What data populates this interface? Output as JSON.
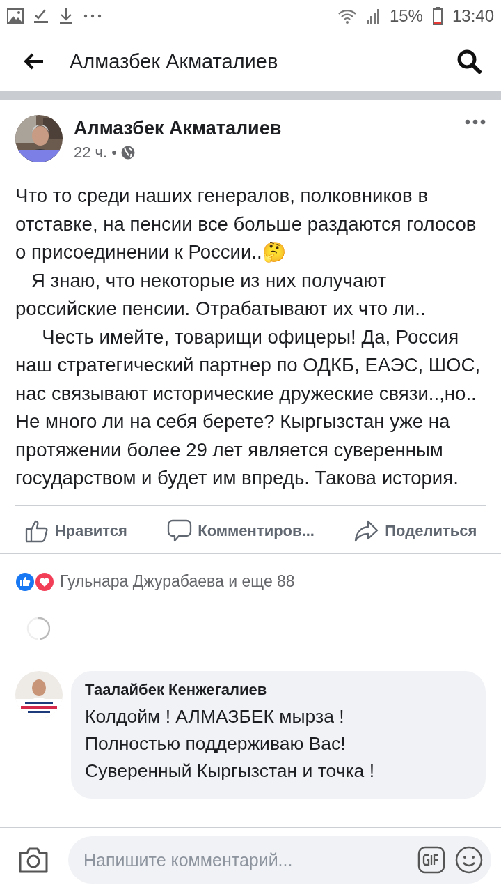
{
  "status_bar": {
    "battery": "15%",
    "time": "13:40"
  },
  "header": {
    "title": "Алмазбек Акматалиев"
  },
  "post": {
    "author": "Алмазбек Акматалиев",
    "time": "22 ч.",
    "separator": "•",
    "paragraphs": [
      {
        "text": "Что то среди наших генералов, полковников в отставке, на пенсии все больше раздаются голосов о присоединении к России..🤔"
      },
      {
        "text": "   Я знаю, что некоторые из них получают российские пенсии. Отрабатывают их что ли.."
      },
      {
        "text": "     Честь имейте, товарищи офицеры! Да, Россия наш стратегический партнер по ОДКБ, ЕАЭС, ШОС, нас связывают исторические дружеские связи..,но.. Не много ли на себя берете? Кыргызстан уже на протяжении более 29 лет является суверенным государством и будет им впредь. Такова история."
      }
    ],
    "actions": [
      {
        "kind": "like",
        "label": "Нравится"
      },
      {
        "kind": "comment",
        "label": "Комментиров..."
      },
      {
        "kind": "share",
        "label": "Поделиться"
      }
    ],
    "reactions": {
      "text": "Гульнара Джурабаева и еще 88"
    }
  },
  "comments": [
    {
      "author": "Таалайбек Кенжегалиев",
      "lines": [
        "Колдойм ! АЛМАЗБЕК мырза !",
        "Полностью поддерживаю Вас!",
        "Суверенный Кыргызстан и точка !"
      ]
    }
  ],
  "composer": {
    "placeholder": "Напишите комментарий..."
  }
}
